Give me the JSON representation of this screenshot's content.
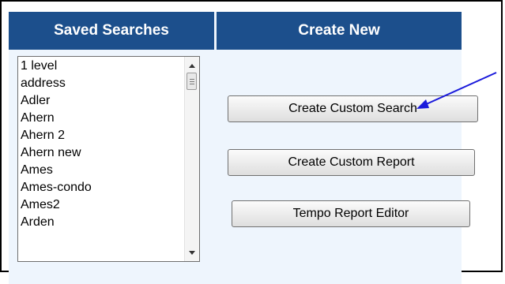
{
  "headers": {
    "saved_searches": "Saved Searches",
    "create_new": "Create New"
  },
  "saved_searches_list": {
    "items": [
      "1 level",
      "address",
      "Adler",
      "Ahern",
      "Ahern 2",
      "Ahern new",
      "Ames",
      "Ames-condo",
      "Ames2",
      "Arden"
    ]
  },
  "buttons": {
    "create_custom_search": "Create Custom Search",
    "create_custom_report": "Create Custom Report",
    "tempo_report_editor": "Tempo Report Editor"
  },
  "colors": {
    "header_bg": "#1c4f8c",
    "panel_bg": "#eef5fd",
    "annotation_arrow": "#1a1adb"
  },
  "icons": {
    "scroll_up": "scroll-up-arrow-icon",
    "scroll_down": "scroll-down-arrow-icon",
    "annotation": "pointer-arrow-icon"
  }
}
